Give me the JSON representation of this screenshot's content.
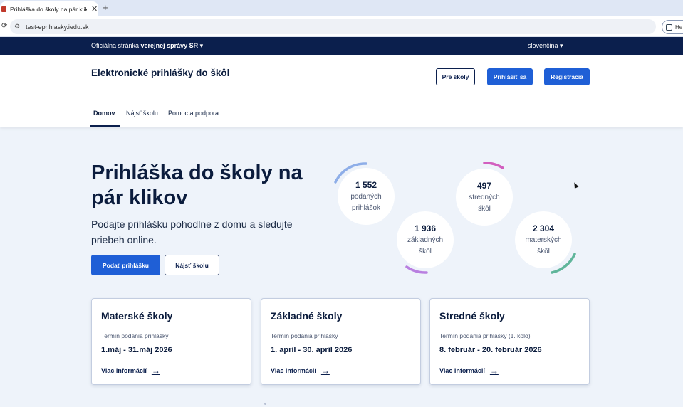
{
  "browser": {
    "tab_title": "Prihláška do školy na pár klikov",
    "tab_close": "✕",
    "new_tab": "+",
    "url": "test-eprihlasky.iedu.sk",
    "extension_label": "He"
  },
  "gov_bar": {
    "official_prefix": "Oficiálna stránka",
    "official_bold": "verejnej správy SR",
    "language": "slovenčina"
  },
  "header": {
    "title": "Elektronické prihlášky do škôl",
    "for_schools": "Pre školy",
    "login": "Prihlásiť sa",
    "register": "Registrácia"
  },
  "nav": {
    "home": "Domov",
    "find_school": "Nájsť školu",
    "help": "Pomoc a podpora"
  },
  "hero": {
    "title": "Prihláška do školy na pár klikov",
    "subtitle": "Podajte prihlášku pohodlne z domu a sledujte priebeh online.",
    "submit_button": "Podať prihlášku",
    "find_button": "Nájsť školu"
  },
  "stats": [
    {
      "number": "1 552",
      "line1": "podaných",
      "line2": "prihlášok",
      "color": "#8eaee8"
    },
    {
      "number": "1 936",
      "line1": "základných",
      "line2": "škôl",
      "color": "#b97fe0"
    },
    {
      "number": "497",
      "line1": "stredných",
      "line2": "škôl",
      "color": "#d25fbf"
    },
    {
      "number": "2 304",
      "line1": "materských",
      "line2": "škôl",
      "color": "#5fb59a"
    }
  ],
  "cards": [
    {
      "title": "Materské školy",
      "label": "Termín podania prihlášky",
      "dates": "1.máj - 31.máj 2026",
      "link": "Viac informácií"
    },
    {
      "title": "Základné školy",
      "label": "Termín podania prihlášky",
      "dates": "1. apríl - 30. apríl 2026",
      "link": "Viac informácií"
    },
    {
      "title": "Stredné školy",
      "label": "Termín podania prihlášky (1. kolo)",
      "dates": "8. február - 20. február 2026",
      "link": "Viac informácií"
    }
  ],
  "colors": {
    "navy": "#0b1f4d",
    "primary_blue": "#1f5fd6",
    "page_bg": "#eef3fa"
  }
}
